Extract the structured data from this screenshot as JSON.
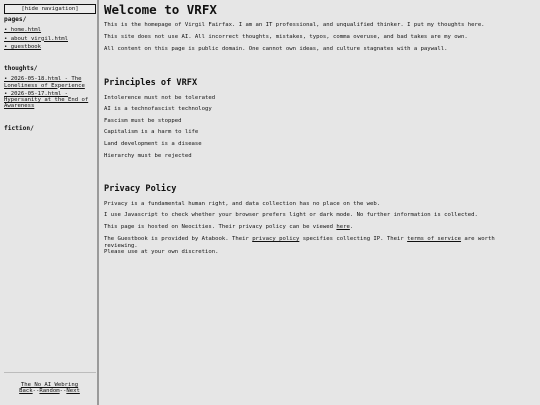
{
  "sidebar": {
    "hide_nav_label": "[hide navigation]",
    "pages_heading": "pages/",
    "pages": [
      "• home.html",
      "• about_virgil.html",
      "• guestbook"
    ],
    "thoughts_heading": "thoughts/",
    "thoughts": [
      "• 2026-05-18.html - The Loneliness of Experience",
      "• 2026-05-17.html - Hypersanity at the End of Awareness"
    ],
    "fiction_heading": "fiction/",
    "webring": {
      "title": "The No AI Webring",
      "back": "Back",
      "sep1": "--",
      "random": "Random",
      "sep2": "--",
      "next": "Next"
    }
  },
  "main": {
    "title": "Welcome to VRFX",
    "intro": [
      "This is the homepage of Virgil Fairfax. I am an IT professional, and unqualified thinker. I put my thoughts here.",
      "This site does not use AI. All incorrect thoughts, mistakes, typos, comma overuse, and bad takes are my own.",
      "All content on this page is public domain. One cannot own ideas, and culture stagnates with a paywall."
    ],
    "principles_heading": "Principles of VRFX",
    "principles": [
      "Intolerence must not be tolerated",
      "AI is a technofascist technology",
      "Fascism must be stopped",
      "Capitalism is a harm to life",
      "Land development is a disease",
      "Hierarchy must be rejected"
    ],
    "privacy_heading": "Privacy Policy",
    "privacy": {
      "p1": "Privacy is a fundamental human right, and data collection has no place on the web.",
      "p2": "I use Javascript to check whether your browser prefers light or dark mode. No further information is collected.",
      "p3_before": "This page is hosted on Neocities. Their privacy policy can be viewed ",
      "p3_link": "here",
      "p3_after": ".",
      "p4_a": "The Guestbook is provided by Atabook. Their ",
      "p4_link1": "privacy policy",
      "p4_b": " specifies collecting IP. Their ",
      "p4_link2": "terms of service",
      "p4_c": " are worth reviewing.",
      "p4_d": "Please use at your own discretion."
    }
  }
}
